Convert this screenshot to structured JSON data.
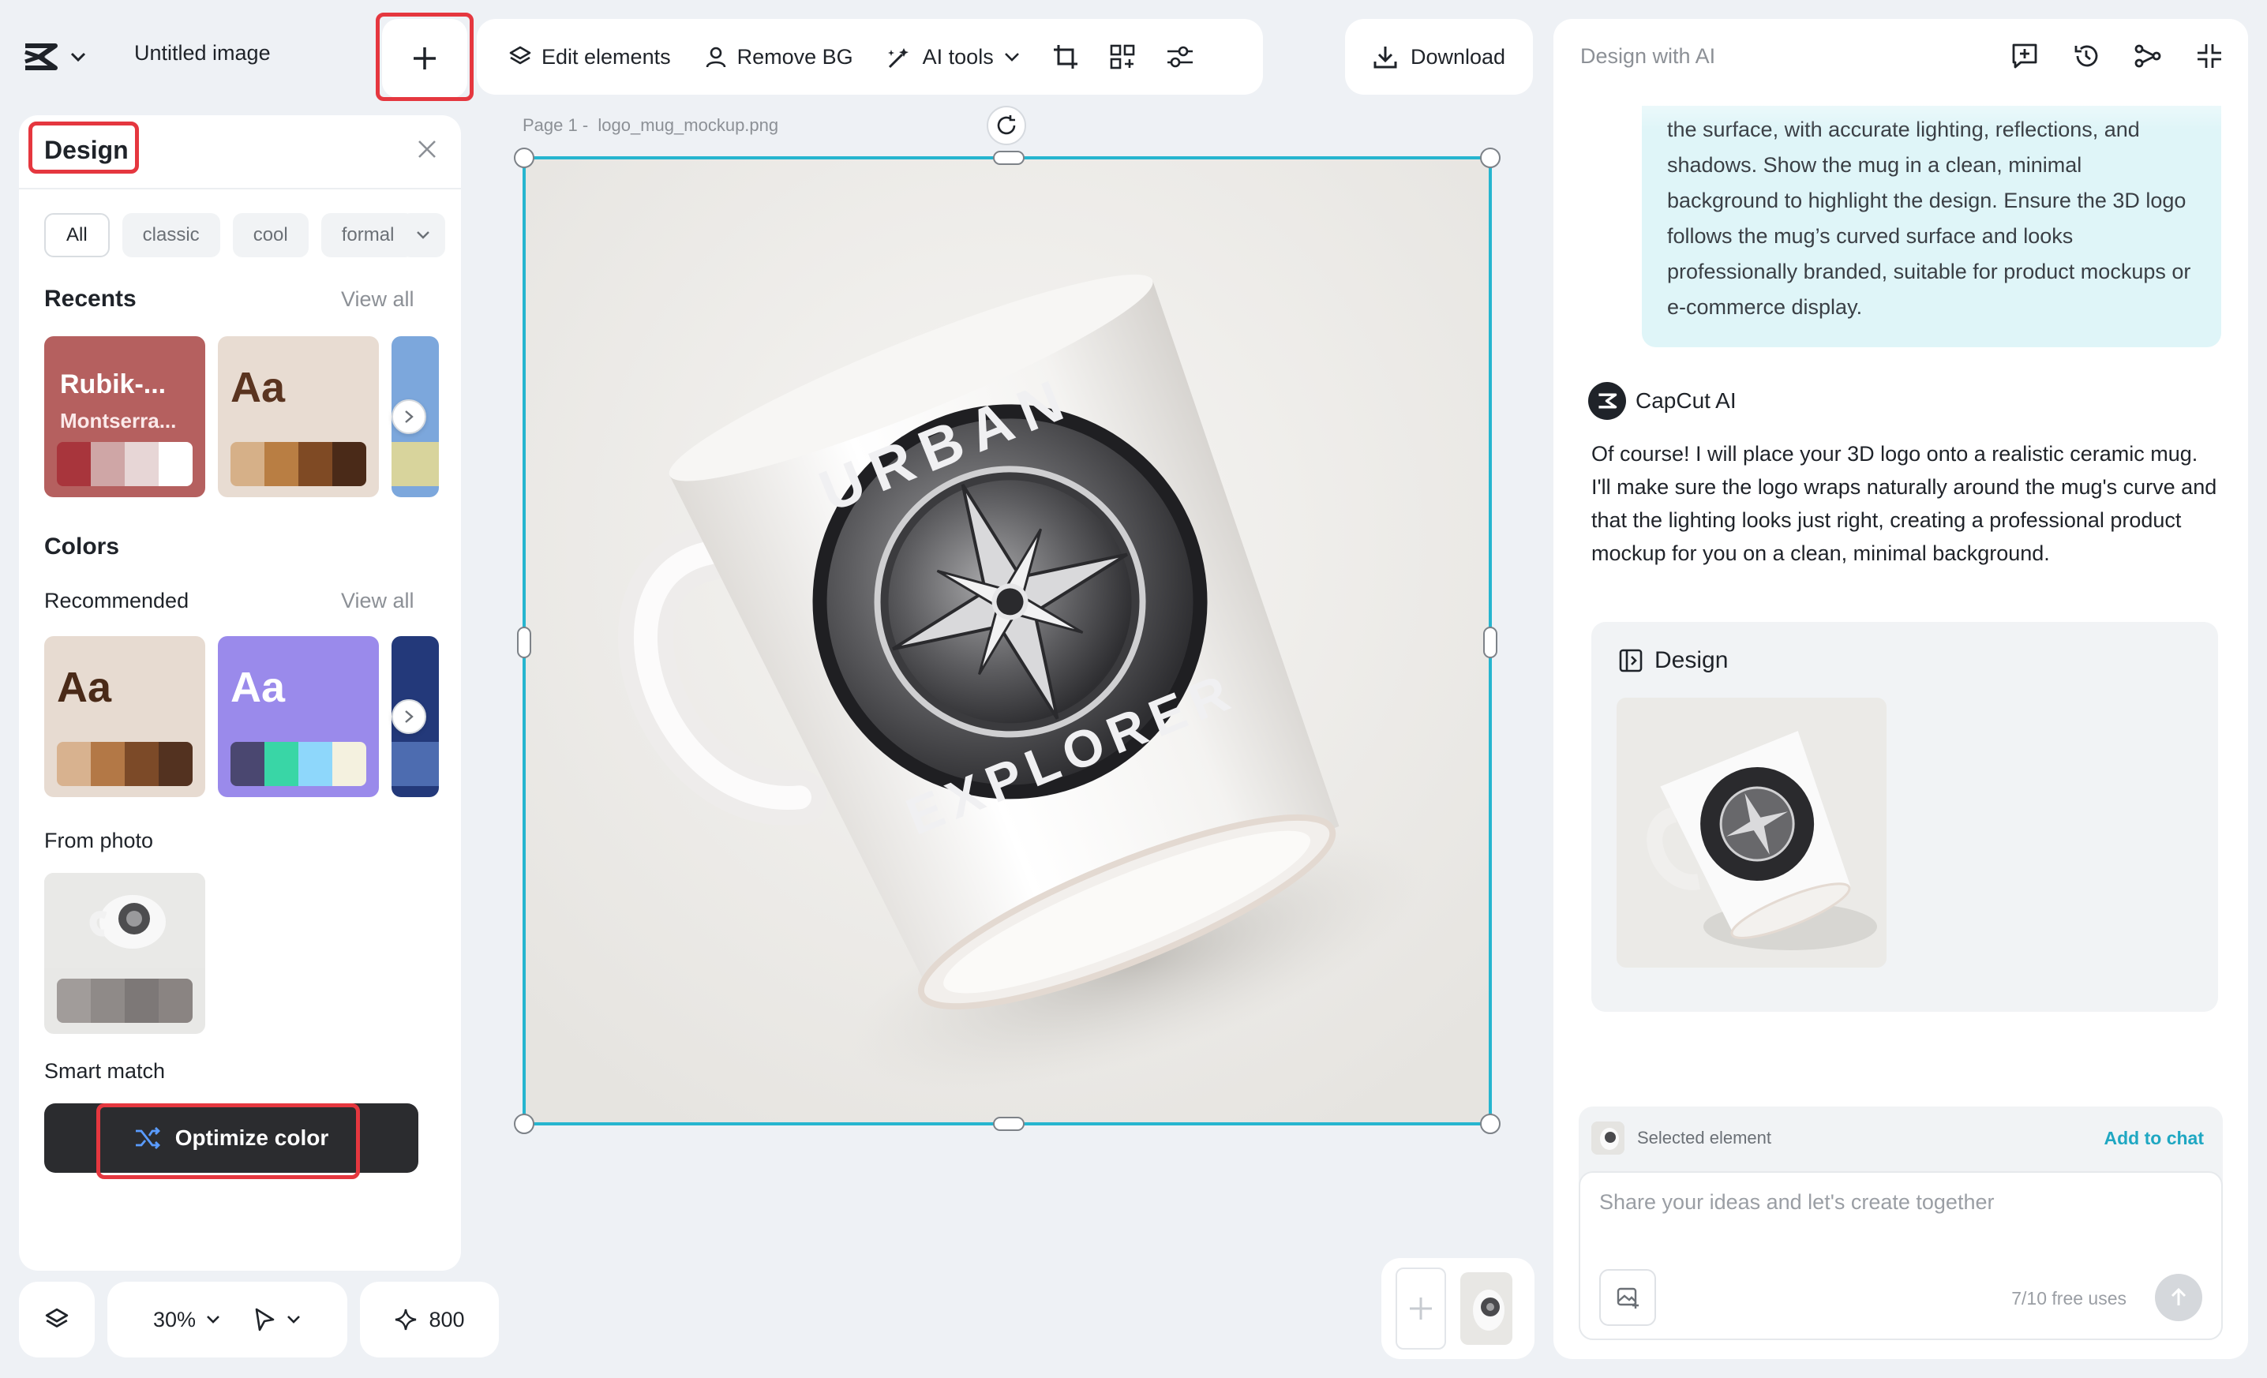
{
  "header": {
    "doc_title": "Untitled image"
  },
  "toolbar": {
    "edit_elements": "Edit elements",
    "remove_bg": "Remove BG",
    "ai_tools": "AI tools",
    "download": "Download"
  },
  "design_panel": {
    "title": "Design",
    "chips": [
      "All",
      "classic",
      "cool",
      "formal"
    ],
    "recents": {
      "title": "Recents",
      "view_all": "View all",
      "tile1": {
        "title": "Rubik-...",
        "subtitle": "Montserra...",
        "bg": "#b5605f",
        "swatches": [
          "#a8353c",
          "#cfa6a6",
          "#e7d6d6",
          "#ffffff"
        ]
      },
      "tile2": {
        "aa": "Aa",
        "bg": "#e8dcd2",
        "swatches": [
          "#d6b088",
          "#b97e43",
          "#7f4a24",
          "#4a2a18"
        ]
      }
    },
    "colors": {
      "title": "Colors",
      "recommended": "Recommended",
      "view_all": "View all",
      "tile1": {
        "aa": "Aa",
        "bg": "#e7dbd1",
        "swatches": [
          "#d8b28f",
          "#b37846",
          "#7c4a28",
          "#533220"
        ]
      },
      "tile2": {
        "aa": "Aa",
        "bg": "#9a8aeb",
        "swatches": [
          "#4a4770",
          "#39d6a6",
          "#8ed7fb",
          "#f4f1df"
        ]
      },
      "from_photo": "From photo",
      "photo_swatches": [
        "#a19c9a",
        "#8f8a88",
        "#7d7877",
        "#8a8482"
      ]
    },
    "smart_match": "Smart match",
    "optimize_color": "Optimize color"
  },
  "bottom_bar": {
    "zoom": "30%",
    "credits": "800"
  },
  "canvas": {
    "page_label": "Page 1 -",
    "file_name": "logo_mug_mockup.png",
    "mug_top_text": "URBAN",
    "mug_bottom_text": "EXPLORER"
  },
  "ai_panel": {
    "title": "Design with AI",
    "user_message": "the surface, with accurate lighting, reflections, and shadows. Show the mug in a clean, minimal background to highlight the design. Ensure the 3D logo follows the mug’s curved surface and looks professionally branded, suitable for product mockups or e-commerce display.",
    "ai_name": "CapCut AI",
    "ai_message": "Of course! I will place your 3D logo onto a realistic ceramic mug. I'll make sure the logo wraps naturally around the mug's curve and that the lighting looks just right, creating a professional product mockup for you on a clean, minimal background.",
    "design_card_title": "Design",
    "selected_element": "Selected element",
    "add_to_chat": "Add to chat",
    "input_placeholder": "Share your ideas and let's create together",
    "free_uses": "7/10 free uses"
  },
  "colors": {
    "accent": "#26b5cf",
    "highlight": "#e5373f",
    "link": "#1fa7c2"
  }
}
